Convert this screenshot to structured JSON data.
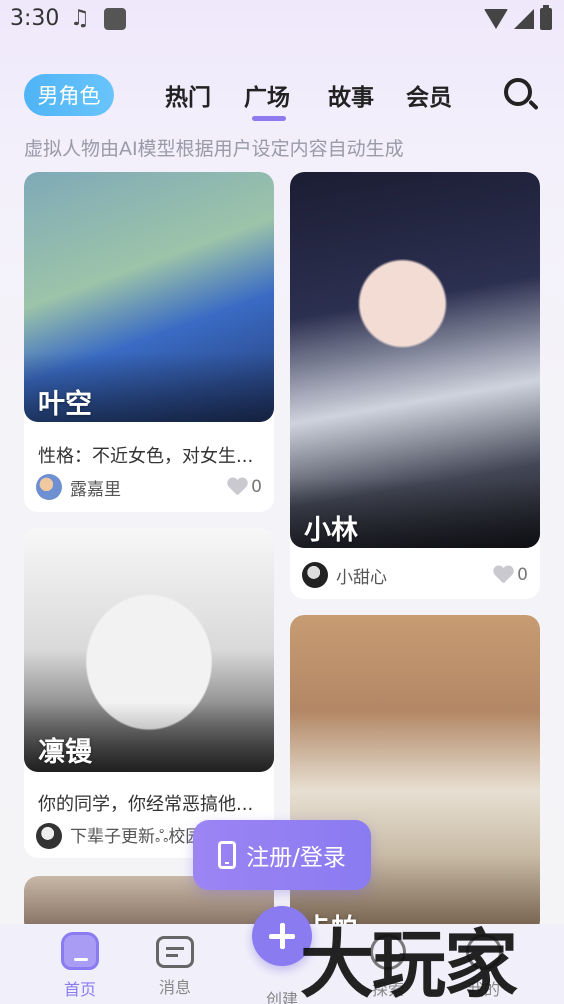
{
  "status": {
    "time": "3:30",
    "music_icon": "♫"
  },
  "topnav": {
    "gender_filter": "男角色",
    "tabs": [
      "热门",
      "广场",
      "故事",
      "会员"
    ],
    "active_tab": "广场"
  },
  "notice": "虚拟人物由AI模型根据用户设定内容自动生成",
  "cards": [
    {
      "name": "叶空",
      "desc": "性格：不近女色，对女生...",
      "author": "露嘉里",
      "likes": "0"
    },
    {
      "name": "小林",
      "author": "小甜心",
      "likes": "0"
    },
    {
      "name": "凛镘",
      "desc": "你的同学，你经常恶搞他...",
      "author": "下辈子更新ஃ校园"
    },
    {
      "name": "卡帕"
    }
  ],
  "login_button": "注册/登录",
  "bottomnav": {
    "items": [
      "首页",
      "消息",
      "创建",
      "探索",
      "我的"
    ],
    "active": "首页"
  },
  "watermark": "大玩家",
  "colors": {
    "accent": "#8a7bf1",
    "pill": "#4fb4f5"
  }
}
